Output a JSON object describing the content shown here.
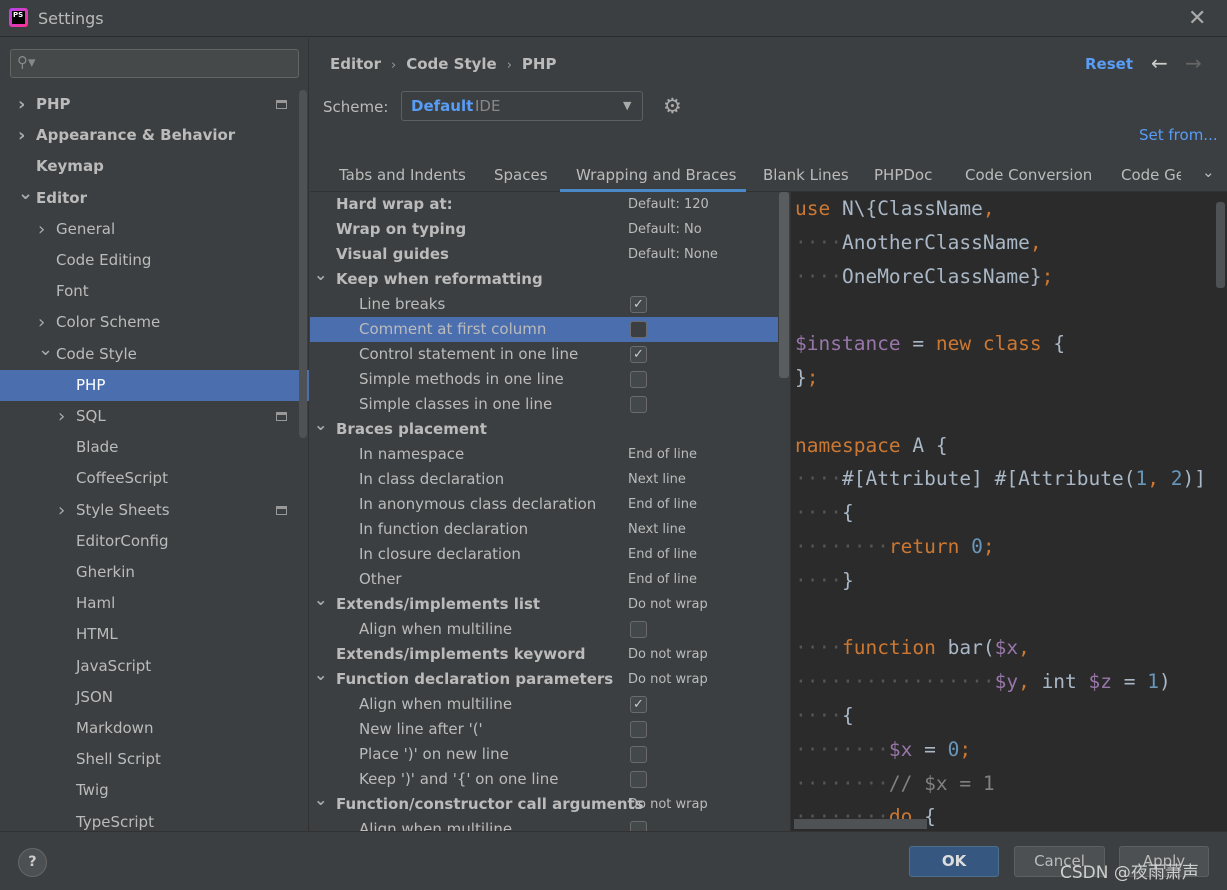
{
  "window": {
    "title": "Settings",
    "icon_text": "PS",
    "close_icon": "close-icon"
  },
  "sidebar": {
    "search_placeholder": "",
    "items": [
      {
        "label": "PHP",
        "level": 0,
        "arrow": "right",
        "bold": true,
        "pin": true
      },
      {
        "label": "Appearance & Behavior",
        "level": 0,
        "arrow": "right",
        "bold": true
      },
      {
        "label": "Keymap",
        "level": 0,
        "bold": true
      },
      {
        "label": "Editor",
        "level": 0,
        "arrow": "down",
        "bold": true
      },
      {
        "label": "General",
        "level": 1,
        "arrow": "right"
      },
      {
        "label": "Code Editing",
        "level": 1
      },
      {
        "label": "Font",
        "level": 1
      },
      {
        "label": "Color Scheme",
        "level": 1,
        "arrow": "right"
      },
      {
        "label": "Code Style",
        "level": 1,
        "arrow": "down"
      },
      {
        "label": "PHP",
        "level": 2,
        "selected": true
      },
      {
        "label": "SQL",
        "level": 2,
        "arrow": "right",
        "pin": true
      },
      {
        "label": "Blade",
        "level": 2
      },
      {
        "label": "CoffeeScript",
        "level": 2
      },
      {
        "label": "Style Sheets",
        "level": 2,
        "arrow": "right",
        "pin": true
      },
      {
        "label": "EditorConfig",
        "level": 2
      },
      {
        "label": "Gherkin",
        "level": 2
      },
      {
        "label": "Haml",
        "level": 2
      },
      {
        "label": "HTML",
        "level": 2
      },
      {
        "label": "JavaScript",
        "level": 2
      },
      {
        "label": "JSON",
        "level": 2
      },
      {
        "label": "Markdown",
        "level": 2
      },
      {
        "label": "Shell Script",
        "level": 2
      },
      {
        "label": "Twig",
        "level": 2
      },
      {
        "label": "TypeScript",
        "level": 2
      }
    ]
  },
  "header": {
    "breadcrumb": [
      "Editor",
      "Code Style",
      "PHP"
    ],
    "reset": "Reset",
    "scheme_label": "Scheme:",
    "scheme_value": "Default",
    "scheme_tag": "IDE",
    "set_from": "Set from..."
  },
  "tabs": [
    {
      "label": "Tabs and Indents"
    },
    {
      "label": "Spaces"
    },
    {
      "label": "Wrapping and Braces",
      "active": true
    },
    {
      "label": "Blank Lines"
    },
    {
      "label": "PHPDoc"
    },
    {
      "label": "Code Conversion"
    },
    {
      "label": "Code Generation"
    }
  ],
  "options": [
    {
      "label": "Hard wrap at:",
      "hdr": true,
      "value": "Default: 120"
    },
    {
      "label": "Wrap on typing",
      "hdr": true,
      "value": "Default: No"
    },
    {
      "label": "Visual guides",
      "hdr": true,
      "value": "Default: None"
    },
    {
      "label": "Keep when reformatting",
      "hdr": true,
      "group": true
    },
    {
      "label": "Line breaks",
      "checked": true
    },
    {
      "label": "Comment at first column",
      "checked": false,
      "selected": true
    },
    {
      "label": "Control statement in one line",
      "checked": true
    },
    {
      "label": "Simple methods in one line",
      "checked": false
    },
    {
      "label": "Simple classes in one line",
      "checked": false
    },
    {
      "label": "Braces placement",
      "hdr": true,
      "group": true
    },
    {
      "label": "In namespace",
      "value": "End of line"
    },
    {
      "label": "In class declaration",
      "value": "Next line"
    },
    {
      "label": "In anonymous class declaration",
      "value": "End of line"
    },
    {
      "label": "In function declaration",
      "value": "Next line"
    },
    {
      "label": "In closure declaration",
      "value": "End of line"
    },
    {
      "label": "Other",
      "value": "End of line"
    },
    {
      "label": "Extends/implements list",
      "hdr": true,
      "group": true,
      "value": "Do not wrap"
    },
    {
      "label": "Align when multiline",
      "checked": false
    },
    {
      "label": "Extends/implements keyword",
      "hdr": true,
      "value": "Do not wrap"
    },
    {
      "label": "Function declaration parameters",
      "hdr": true,
      "group": true,
      "value": "Do not wrap"
    },
    {
      "label": "Align when multiline",
      "checked": true
    },
    {
      "label": "New line after '('",
      "checked": false
    },
    {
      "label": "Place ')' on new line",
      "checked": false
    },
    {
      "label": "Keep ')' and '{' on one line",
      "checked": false
    },
    {
      "label": "Function/constructor call arguments",
      "hdr": true,
      "group": true,
      "value": "Do not wrap"
    },
    {
      "label": "Align when multiline",
      "checked": false
    }
  ],
  "code": [
    [
      [
        "use",
        "kw"
      ],
      [
        " N\\{ClassName",
        ""
      ],
      [
        ",",
        "pn"
      ]
    ],
    [
      [
        "····",
        "ws"
      ],
      [
        "AnotherClassName",
        ""
      ],
      [
        ",",
        "pn"
      ]
    ],
    [
      [
        "····",
        "ws"
      ],
      [
        "OneMoreClassName}",
        ""
      ],
      [
        ";",
        "pn"
      ]
    ],
    [],
    [
      [
        "$instance",
        "vr"
      ],
      [
        " = ",
        ""
      ],
      [
        "new",
        "kw"
      ],
      [
        " ",
        ""
      ],
      [
        "class",
        "kw"
      ],
      [
        " {",
        ""
      ]
    ],
    [
      [
        "}",
        ""
      ],
      [
        ";",
        "pn"
      ]
    ],
    [],
    [
      [
        "namespace",
        "kw"
      ],
      [
        " A {",
        ""
      ]
    ],
    [
      [
        "····",
        "ws"
      ],
      [
        "#[Attribute] #[Attribute(",
        ""
      ],
      [
        "1",
        "nm"
      ],
      [
        ", ",
        "pn"
      ],
      [
        "2",
        "nm"
      ],
      [
        ")]",
        ""
      ]
    ],
    [
      [
        "····",
        "ws"
      ],
      [
        "{",
        ""
      ]
    ],
    [
      [
        "········",
        "ws"
      ],
      [
        "return",
        "kw"
      ],
      [
        " ",
        ""
      ],
      [
        "0",
        "nm"
      ],
      [
        ";",
        "pn"
      ]
    ],
    [
      [
        "····",
        "ws"
      ],
      [
        "}",
        ""
      ]
    ],
    [],
    [
      [
        "····",
        "ws"
      ],
      [
        "function",
        "kw"
      ],
      [
        " bar(",
        ""
      ],
      [
        "$x",
        "vr"
      ],
      [
        ",",
        "pn"
      ]
    ],
    [
      [
        "·················",
        "ws"
      ],
      [
        "$y",
        "vr"
      ],
      [
        ",",
        "pn"
      ],
      [
        " int ",
        ""
      ],
      [
        "$z",
        "vr"
      ],
      [
        " = ",
        ""
      ],
      [
        "1",
        "nm"
      ],
      [
        ")",
        ""
      ]
    ],
    [
      [
        "····",
        "ws"
      ],
      [
        "{",
        ""
      ]
    ],
    [
      [
        "········",
        "ws"
      ],
      [
        "$x",
        "vr"
      ],
      [
        " = ",
        ""
      ],
      [
        "0",
        "nm"
      ],
      [
        ";",
        "pn"
      ]
    ],
    [
      [
        "········",
        "ws"
      ],
      [
        "// $x = 1",
        "cm"
      ]
    ],
    [
      [
        "········",
        "ws"
      ],
      [
        "do",
        "kw"
      ],
      [
        " {",
        ""
      ]
    ]
  ],
  "footer": {
    "help": "?",
    "ok": "OK",
    "cancel": "Cancel",
    "apply": "Apply",
    "watermark": "CSDN @夜雨萧声"
  },
  "colors": {
    "accent": "#4b6eaf",
    "link": "#589df6",
    "keyword": "#cc7832",
    "variable": "#9876aa",
    "number": "#6897bb"
  }
}
